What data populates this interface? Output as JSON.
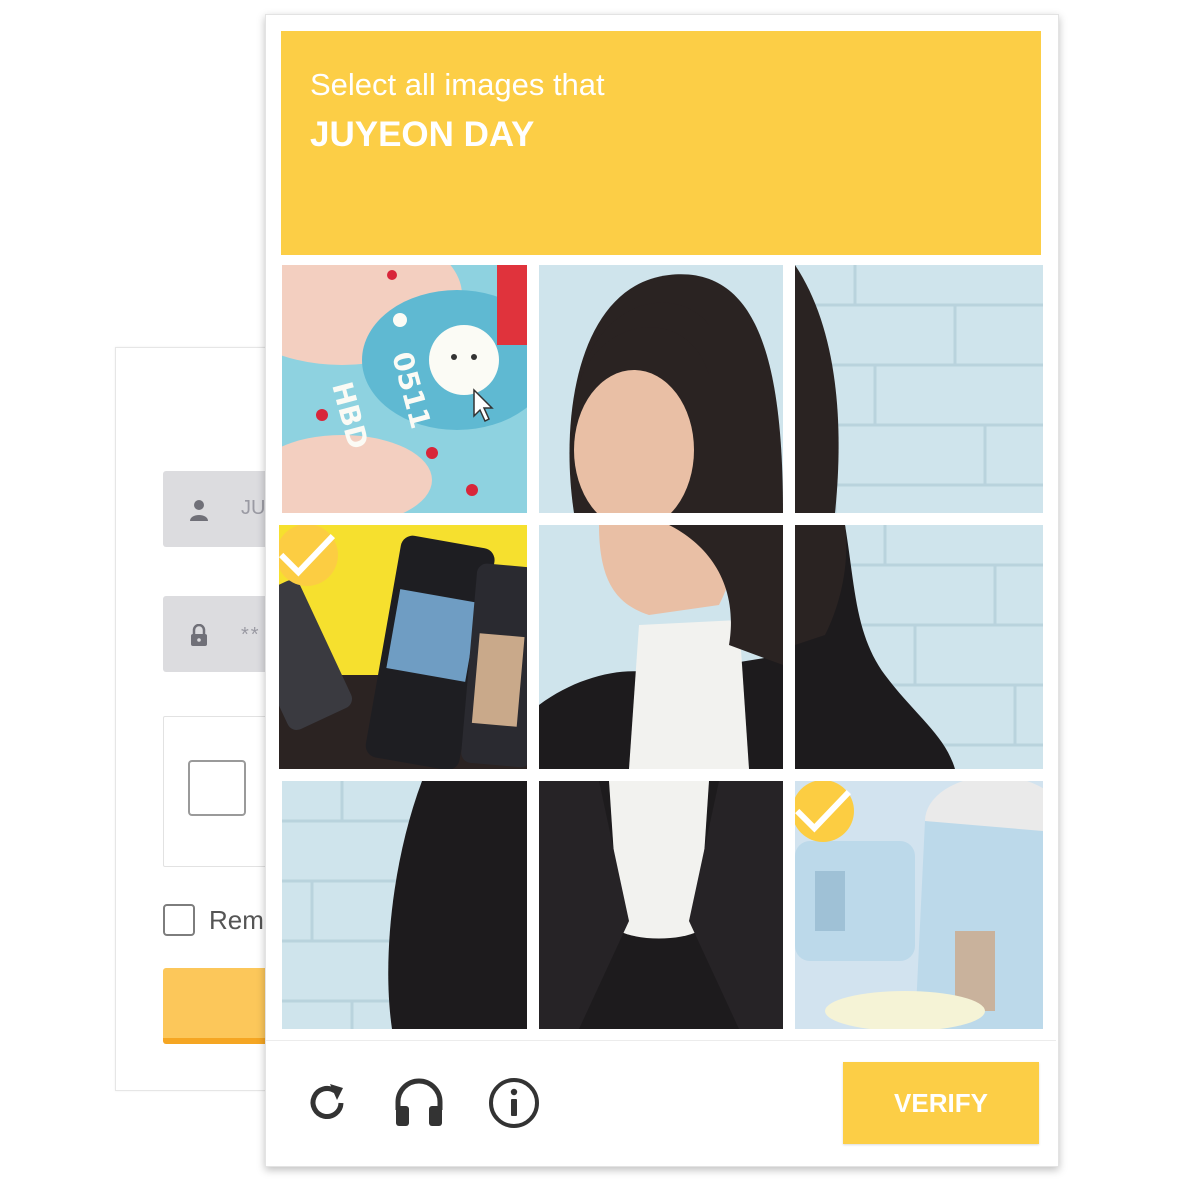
{
  "login": {
    "username_value": "JU",
    "password_value": "**",
    "remember_label": "Rem"
  },
  "captcha": {
    "prompt": "Select all images that",
    "target": "JUYEON DAY",
    "tiles": [
      {
        "row": 1,
        "col": 1,
        "content": "birthday cake reading HBD 0511",
        "selected": false
      },
      {
        "row": 1,
        "col": 2,
        "content": "photo of a woman, part",
        "selected": false
      },
      {
        "row": 1,
        "col": 3,
        "content": "photo of a woman, part",
        "selected": false
      },
      {
        "row": 2,
        "col": 1,
        "content": "photo cans merchandise",
        "selected": true
      },
      {
        "row": 2,
        "col": 2,
        "content": "photo of a woman, part",
        "selected": false
      },
      {
        "row": 2,
        "col": 3,
        "content": "photo of a woman, part",
        "selected": false
      },
      {
        "row": 3,
        "col": 1,
        "content": "photo of a woman, part",
        "selected": false
      },
      {
        "row": 3,
        "col": 2,
        "content": "photo of a woman, part",
        "selected": false
      },
      {
        "row": 3,
        "col": 3,
        "content": "photo cup merchandise",
        "selected": true
      }
    ],
    "cake_text": [
      "HBD",
      "0511"
    ],
    "footer": {
      "icons": [
        "reload-icon",
        "headphones-icon",
        "info-icon"
      ],
      "verify_label": "VERIFY"
    }
  },
  "colors": {
    "accent": "#fcce46",
    "login_button": "#fcc75a",
    "login_button_border": "#f5a623",
    "field_bg": "#dcdcdf"
  }
}
